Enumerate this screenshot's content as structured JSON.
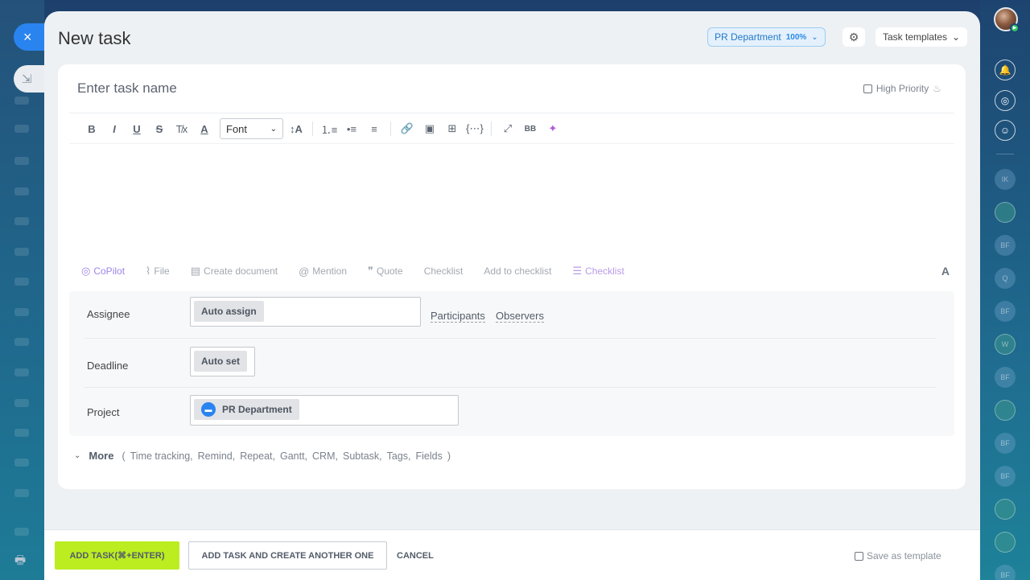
{
  "window": {
    "title": "New task",
    "close_icon": "×",
    "minimize_icon": "⇲",
    "print_icon": "🖶"
  },
  "header": {
    "project_chip": {
      "label": "PR Department",
      "percent": "100%",
      "chevron": "⌄"
    },
    "settings_icon": "⚙",
    "templates": {
      "label": "Task templates",
      "chevron": "⌄"
    }
  },
  "task": {
    "name_placeholder": "Enter task name",
    "high_priority": "High Priority",
    "priority_checked": false
  },
  "toolbar": {
    "bold": "B",
    "italic": "I",
    "underline": "U",
    "strike": "S",
    "clear_format": "T̸x",
    "font_color": "A",
    "font_select": "Font",
    "font_size": "↕A",
    "numbered_list": "⒈≡",
    "bullet_list": "•≡",
    "align": "≡",
    "link": "🔗",
    "image": "▣",
    "table": "⊞",
    "code": "{⋯}",
    "fullscreen": "⤢",
    "bbcode": "BB",
    "ai_image": "✦"
  },
  "actions": {
    "copilot": "CoPilot",
    "file": "File",
    "create_document": "Create document",
    "mention": "Mention",
    "quote": "Quote",
    "checklist": "Checklist",
    "add_to_checklist": "Add to checklist",
    "checklist_new": "Checklist",
    "text_format": "A"
  },
  "fields": {
    "assignee": {
      "label": "Assignee",
      "value": "Auto assign",
      "participants": "Participants",
      "observers": "Observers"
    },
    "deadline": {
      "label": "Deadline",
      "value": "Auto set"
    },
    "project": {
      "label": "Project",
      "value": "PR Department"
    }
  },
  "more": {
    "label": "More",
    "open": "(",
    "options": [
      "Time tracking,",
      "Remind,",
      "Repeat,",
      "Gantt,",
      "CRM,",
      "Subtask,",
      "Tags,",
      "Fields"
    ],
    "close": ")"
  },
  "footer": {
    "add_task": "ADD TASK(⌘+ENTER)",
    "add_task_another": "ADD TASK AND CREATE ANOTHER ONE",
    "cancel": "CANCEL",
    "save_template": "Save as template"
  },
  "right_sidebar": {
    "avatars": [
      "IK",
      "",
      "BF",
      "Q",
      "BF",
      "W",
      "BF",
      "",
      "BF",
      "BF",
      "",
      "",
      "BF"
    ]
  },
  "colors": {
    "accent": "#2a84f0",
    "add_button": "#bbed21",
    "copilot": "#9f86e6"
  }
}
